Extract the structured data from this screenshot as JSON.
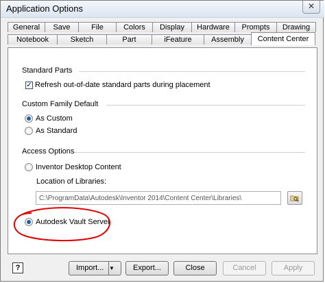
{
  "window": {
    "title": "Application Options",
    "close_glyph": "✕"
  },
  "tabs_back": [
    "General",
    "Save",
    "File",
    "Colors",
    "Display",
    "Hardware",
    "Prompts",
    "Drawing"
  ],
  "tabs_front": [
    "Notebook",
    "Sketch",
    "Part",
    "iFeature",
    "Assembly",
    "Content Center"
  ],
  "active_tab": "Content Center",
  "standard_parts": {
    "title": "Standard Parts",
    "refresh_label": "Refresh out-of-date standard parts during placement",
    "refresh_checked": true
  },
  "custom_family": {
    "title": "Custom Family Default",
    "options": [
      "As Custom",
      "As Standard"
    ],
    "selected": "As Custom"
  },
  "access_options": {
    "title": "Access Options",
    "desktop_label": "Inventor Desktop Content",
    "location_label": "Location of Libraries:",
    "location_value": "C:\\ProgramData\\Autodesk\\Inventor 2014\\Content Center\\Libraries\\",
    "vault_label": "Autodesk Vault Server",
    "selected": "Autodesk Vault Server"
  },
  "buttons": {
    "help": "?",
    "import": "Import...",
    "export": "Export...",
    "close": "Close",
    "cancel": "Cancel",
    "apply": "Apply"
  },
  "icons": {
    "browse": "folder-browse-icon",
    "help": "help-icon",
    "dropdown": "triangle-down-icon"
  },
  "annotation_color": "#e00000"
}
